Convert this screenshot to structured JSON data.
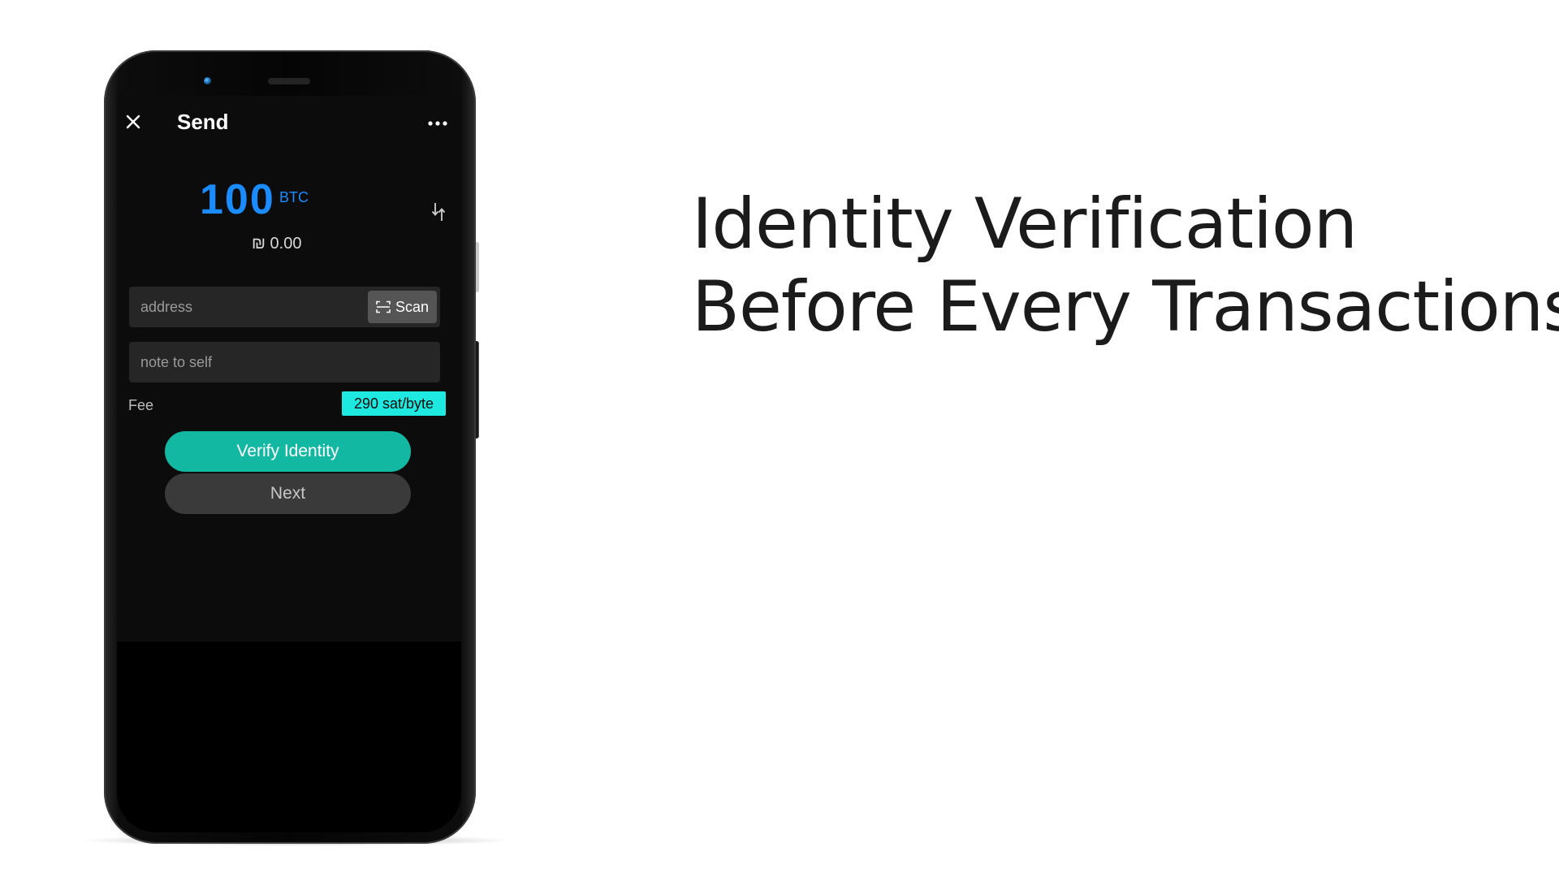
{
  "headline": {
    "line1": "Identity Verification",
    "line2": "Before Every Transactions"
  },
  "app": {
    "title": "Send",
    "amount": "100",
    "currency": "BTC",
    "fiat_value": "₪ 0.00",
    "address_placeholder": "address",
    "scan_label": "Scan",
    "note_placeholder": "note to self",
    "fee_label": "Fee",
    "fee_value": "290 sat/byte",
    "verify_button": "Verify Identity",
    "next_button": "Next"
  },
  "colors": {
    "amount_blue": "#1a8cff",
    "verify_teal": "#13b8a2",
    "fee_cyan": "#1de9e0",
    "app_background": "#0c0c0c"
  },
  "icons": {
    "close": "close-icon",
    "more": "more-horizontal-icon",
    "swap": "swap-arrows-icon",
    "scan": "scan-frame-icon"
  }
}
